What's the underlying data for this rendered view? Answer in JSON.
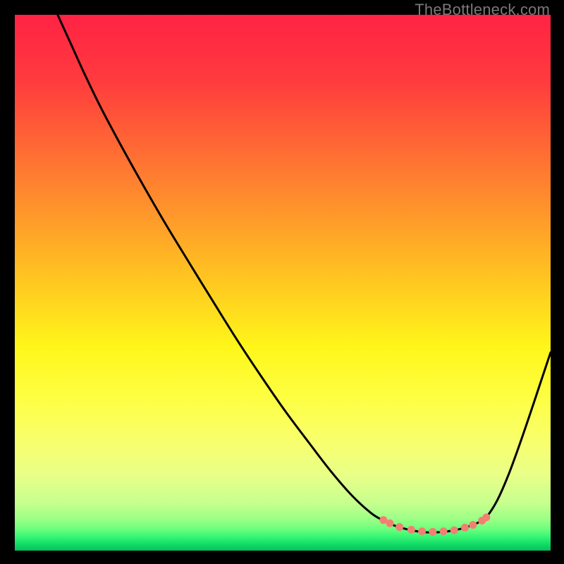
{
  "watermark": "TheBottleneck.com",
  "gradient": {
    "stops": [
      {
        "offset": 0.0,
        "color": "#ff2344"
      },
      {
        "offset": 0.12,
        "color": "#ff3a3e"
      },
      {
        "offset": 0.25,
        "color": "#ff6a34"
      },
      {
        "offset": 0.38,
        "color": "#ff9a2a"
      },
      {
        "offset": 0.5,
        "color": "#ffc820"
      },
      {
        "offset": 0.62,
        "color": "#fff61a"
      },
      {
        "offset": 0.72,
        "color": "#fdff45"
      },
      {
        "offset": 0.8,
        "color": "#f8ff6f"
      },
      {
        "offset": 0.86,
        "color": "#e8ff88"
      },
      {
        "offset": 0.91,
        "color": "#c7ff8e"
      },
      {
        "offset": 0.94,
        "color": "#9eff86"
      },
      {
        "offset": 0.96,
        "color": "#6bff7d"
      },
      {
        "offset": 0.975,
        "color": "#33f573"
      },
      {
        "offset": 0.99,
        "color": "#0fd765"
      },
      {
        "offset": 1.0,
        "color": "#07c05a"
      }
    ]
  },
  "curve_xy": [
    [
      0.08,
      0.0
    ],
    [
      0.105,
      0.055
    ],
    [
      0.13,
      0.11
    ],
    [
      0.16,
      0.172
    ],
    [
      0.195,
      0.238
    ],
    [
      0.235,
      0.31
    ],
    [
      0.28,
      0.388
    ],
    [
      0.325,
      0.462
    ],
    [
      0.37,
      0.535
    ],
    [
      0.415,
      0.607
    ],
    [
      0.46,
      0.675
    ],
    [
      0.505,
      0.74
    ],
    [
      0.55,
      0.8
    ],
    [
      0.59,
      0.852
    ],
    [
      0.63,
      0.898
    ],
    [
      0.665,
      0.93
    ],
    [
      0.688,
      0.944
    ],
    [
      0.7,
      0.95
    ],
    [
      0.72,
      0.957
    ],
    [
      0.745,
      0.963
    ],
    [
      0.77,
      0.966
    ],
    [
      0.8,
      0.965
    ],
    [
      0.83,
      0.96
    ],
    [
      0.855,
      0.952
    ],
    [
      0.87,
      0.945
    ],
    [
      0.88,
      0.938
    ],
    [
      0.9,
      0.907
    ],
    [
      0.92,
      0.862
    ],
    [
      0.94,
      0.808
    ],
    [
      0.96,
      0.75
    ],
    [
      0.98,
      0.69
    ],
    [
      1.0,
      0.63
    ]
  ],
  "markers_xy": [
    [
      0.688,
      0.943
    ],
    [
      0.7,
      0.949
    ],
    [
      0.718,
      0.956
    ],
    [
      0.74,
      0.961
    ],
    [
      0.76,
      0.964
    ],
    [
      0.78,
      0.965
    ],
    [
      0.8,
      0.964
    ],
    [
      0.82,
      0.962
    ],
    [
      0.84,
      0.957
    ],
    [
      0.855,
      0.952
    ],
    [
      0.872,
      0.944
    ],
    [
      0.88,
      0.938
    ]
  ],
  "marker_color": "#f18073",
  "curve_stroke_width": 3,
  "marker_radius": 5.5,
  "chart_data": {
    "type": "line",
    "title": "",
    "xlabel": "",
    "ylabel": "",
    "xlim": [
      0,
      1
    ],
    "ylim": [
      0,
      1
    ],
    "series": [
      {
        "name": "curve",
        "x": [
          0.08,
          0.105,
          0.13,
          0.16,
          0.195,
          0.235,
          0.28,
          0.325,
          0.37,
          0.415,
          0.46,
          0.505,
          0.55,
          0.59,
          0.63,
          0.665,
          0.688,
          0.7,
          0.72,
          0.745,
          0.77,
          0.8,
          0.83,
          0.855,
          0.87,
          0.88,
          0.9,
          0.92,
          0.94,
          0.96,
          0.98,
          1.0
        ],
        "y": [
          1.0,
          0.945,
          0.89,
          0.828,
          0.762,
          0.69,
          0.612,
          0.538,
          0.465,
          0.393,
          0.325,
          0.26,
          0.2,
          0.148,
          0.102,
          0.07,
          0.056,
          0.05,
          0.043,
          0.037,
          0.034,
          0.035,
          0.04,
          0.048,
          0.055,
          0.062,
          0.093,
          0.138,
          0.192,
          0.25,
          0.31,
          0.37
        ]
      },
      {
        "name": "highlighted-points",
        "x": [
          0.688,
          0.7,
          0.718,
          0.74,
          0.76,
          0.78,
          0.8,
          0.82,
          0.84,
          0.855,
          0.872,
          0.88
        ],
        "y": [
          0.057,
          0.051,
          0.044,
          0.039,
          0.036,
          0.035,
          0.036,
          0.038,
          0.043,
          0.048,
          0.056,
          0.062
        ]
      }
    ]
  }
}
